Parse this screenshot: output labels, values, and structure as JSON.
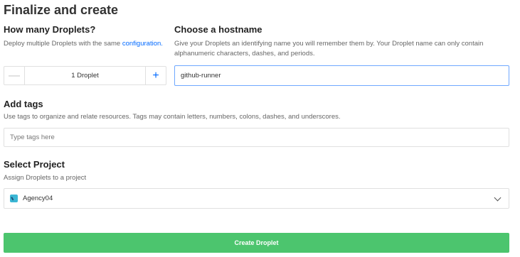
{
  "page": {
    "title": "Finalize and create"
  },
  "droplets": {
    "heading": "How many Droplets?",
    "desc_prefix": "Deploy multiple Droplets with the same ",
    "desc_link": "configuration.",
    "count_label": "1  Droplet",
    "minus_symbol": "—",
    "plus_symbol": "+"
  },
  "hostname": {
    "heading": "Choose a hostname",
    "desc": "Give your Droplets an identifying name you will remember them by. Your Droplet name can only contain alphanumeric characters, dashes, and periods.",
    "value": "github-runner"
  },
  "tags": {
    "heading": "Add tags",
    "desc": "Use tags to organize and relate resources. Tags may contain letters, numbers, colons, dashes, and underscores.",
    "placeholder": "Type tags here"
  },
  "project": {
    "heading": "Select Project",
    "desc": "Assign Droplets to a project",
    "selected": "Agency04",
    "icon": "project-icon"
  },
  "actions": {
    "create_label": "Create Droplet"
  },
  "colors": {
    "accent": "#0069ff",
    "create_button": "#4cc56e",
    "focus_border": "#6fa8ff"
  }
}
